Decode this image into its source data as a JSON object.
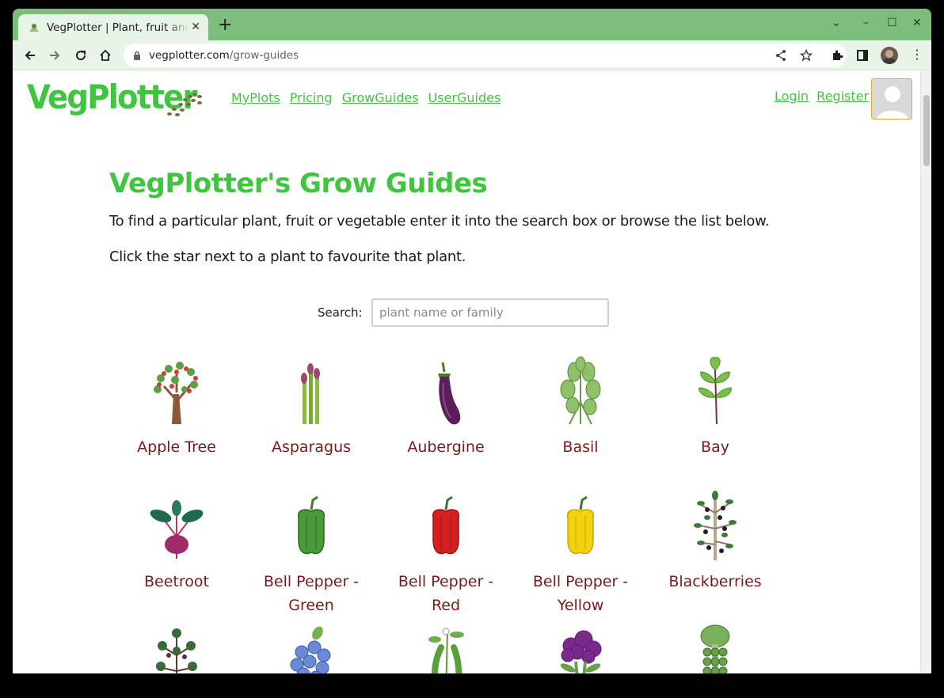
{
  "browser": {
    "tab_title": "VegPlotter | Plant, fruit and vegetable grow guides",
    "url_domain": "vegplotter.com",
    "url_path": "/grow-guides",
    "theme_color": "#7cbd7c"
  },
  "site": {
    "logo": "VegPlotter",
    "nav": [
      "MyPlots",
      "Pricing",
      "GrowGuides",
      "UserGuides"
    ],
    "login": "Login",
    "register": "Register",
    "brand_color": "#41c541"
  },
  "page": {
    "title": "VegPlotter's Grow Guides",
    "intro1": "To find a particular plant, fruit or vegetable enter it into the search box or browse the list below.",
    "intro2": "Click the star next to a plant to favourite that plant.",
    "search_label": "Search:",
    "search_placeholder": "plant name or family"
  },
  "plants": [
    {
      "name": "Apple Tree",
      "icon": "apple-tree-icon"
    },
    {
      "name": "Asparagus",
      "icon": "asparagus-icon"
    },
    {
      "name": "Aubergine",
      "icon": "aubergine-icon"
    },
    {
      "name": "Basil",
      "icon": "basil-icon"
    },
    {
      "name": "Bay",
      "icon": "bay-icon"
    },
    {
      "name": "Beetroot",
      "icon": "beetroot-icon"
    },
    {
      "name": "Bell Pepper - Green",
      "icon": "green-pepper-icon"
    },
    {
      "name": "Bell Pepper - Red",
      "icon": "red-pepper-icon"
    },
    {
      "name": "Bell Pepper - Yellow",
      "icon": "yellow-pepper-icon"
    },
    {
      "name": "Blackberries",
      "icon": "blackberries-icon"
    },
    {
      "name": "",
      "icon": "blackcurrant-icon"
    },
    {
      "name": "",
      "icon": "blueberries-icon"
    },
    {
      "name": "",
      "icon": "broad-beans-icon"
    },
    {
      "name": "",
      "icon": "purple-broccoli-icon"
    },
    {
      "name": "",
      "icon": "brussels-sprouts-icon"
    }
  ]
}
